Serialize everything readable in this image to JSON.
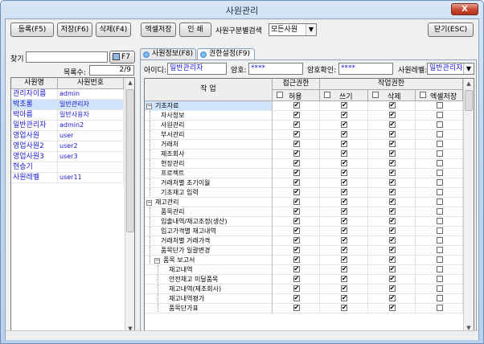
{
  "window": {
    "title": "사원관리",
    "close_glyph": "X"
  },
  "toolbar": {
    "register": "등록(F5)",
    "save": "저장(F6)",
    "delete": "삭제(F4)",
    "excel_save": "엑셀저장",
    "print": "인 쇄",
    "search_label": "사원구분별검색",
    "search_value": "모든사원",
    "close": "닫기(ESC)"
  },
  "left": {
    "find_label": "찾기",
    "find_value": "",
    "find_button": "F7",
    "count_label": "목록수:",
    "count_value": "2/9",
    "headers": [
      "사원명",
      "사원번호"
    ],
    "rows": [
      [
        "관리자이름",
        "admin"
      ],
      [
        "박초롱",
        "일반관리자"
      ],
      [
        "박아름",
        "일반사용자"
      ],
      [
        "일반관리자",
        "admin2"
      ],
      [
        "영업사원",
        "user"
      ],
      [
        "영업사원2",
        "user2"
      ],
      [
        "영업사원3",
        "user3"
      ],
      [
        "현승기",
        ""
      ],
      [
        "사원레벨",
        "user11"
      ]
    ],
    "selected_index": 1
  },
  "tabs": [
    {
      "label": "사원정보(F8)",
      "active": false
    },
    {
      "label": "권한설정(F9)",
      "active": true
    }
  ],
  "form": {
    "id_label": "아이디:",
    "id_value": "일반관리자",
    "pw_label": "암호:",
    "pw_value": "****",
    "pw_confirm_label": "암호확인:",
    "pw_confirm_value": "****",
    "level_label": "사원레벨:",
    "level_value": "일반관리자"
  },
  "grid": {
    "task_header": "작  업",
    "access_header": "접근권한",
    "perm_header": "작업권한",
    "sub_headers": [
      "허용",
      "쓰기",
      "삭제",
      "엑셀저장"
    ],
    "rows": [
      {
        "label": "기초자료",
        "level": 0,
        "group": true,
        "checks": [
          true,
          true,
          true,
          false
        ]
      },
      {
        "label": "자사정보",
        "level": 1,
        "group": false,
        "checks": [
          true,
          true,
          true,
          false
        ]
      },
      {
        "label": "사원관리",
        "level": 1,
        "group": false,
        "checks": [
          true,
          true,
          true,
          false
        ]
      },
      {
        "label": "부서관리",
        "level": 1,
        "group": false,
        "checks": [
          true,
          true,
          true,
          false
        ]
      },
      {
        "label": "거래처",
        "level": 1,
        "group": false,
        "checks": [
          true,
          true,
          true,
          false
        ]
      },
      {
        "label": "제조회사",
        "level": 1,
        "group": false,
        "checks": [
          true,
          true,
          true,
          false
        ]
      },
      {
        "label": "현장관리",
        "level": 1,
        "group": false,
        "checks": [
          true,
          true,
          true,
          false
        ]
      },
      {
        "label": "프로젝트",
        "level": 1,
        "group": false,
        "checks": [
          true,
          true,
          true,
          false
        ]
      },
      {
        "label": "거래처별 초기이월",
        "level": 1,
        "group": false,
        "checks": [
          true,
          true,
          true,
          false
        ]
      },
      {
        "label": "기초재고 입력",
        "level": 1,
        "group": false,
        "checks": [
          true,
          true,
          true,
          false
        ]
      },
      {
        "label": "재고관리",
        "level": 0,
        "group": true,
        "checks": [
          true,
          true,
          true,
          false
        ]
      },
      {
        "label": "품목관리",
        "level": 1,
        "group": false,
        "checks": [
          true,
          true,
          true,
          false
        ]
      },
      {
        "label": "입출내역/재고조정(생산)",
        "level": 1,
        "group": false,
        "checks": [
          true,
          true,
          true,
          false
        ]
      },
      {
        "label": "입고가격별 재고내역",
        "level": 1,
        "group": false,
        "checks": [
          true,
          true,
          true,
          false
        ]
      },
      {
        "label": "거래처별 거래가격",
        "level": 1,
        "group": false,
        "checks": [
          true,
          true,
          true,
          false
        ]
      },
      {
        "label": "품목단가 일괄변경",
        "level": 1,
        "group": false,
        "checks": [
          true,
          true,
          true,
          false
        ]
      },
      {
        "label": "품목 보고서",
        "level": 1,
        "group": true,
        "checks": [
          true,
          true,
          true,
          false
        ]
      },
      {
        "label": "재고내역",
        "level": 2,
        "group": false,
        "checks": [
          true,
          true,
          true,
          false
        ]
      },
      {
        "label": "안전재고 미달품목",
        "level": 2,
        "group": false,
        "checks": [
          true,
          true,
          true,
          false
        ]
      },
      {
        "label": "재고내역(제조회사)",
        "level": 2,
        "group": false,
        "checks": [
          true,
          true,
          true,
          false
        ]
      },
      {
        "label": "재고내역평가",
        "level": 2,
        "group": false,
        "checks": [
          true,
          true,
          true,
          false
        ]
      },
      {
        "label": "품목단가표",
        "level": 2,
        "group": false,
        "checks": [
          true,
          true,
          true,
          false
        ]
      }
    ],
    "selected_index": 0
  }
}
